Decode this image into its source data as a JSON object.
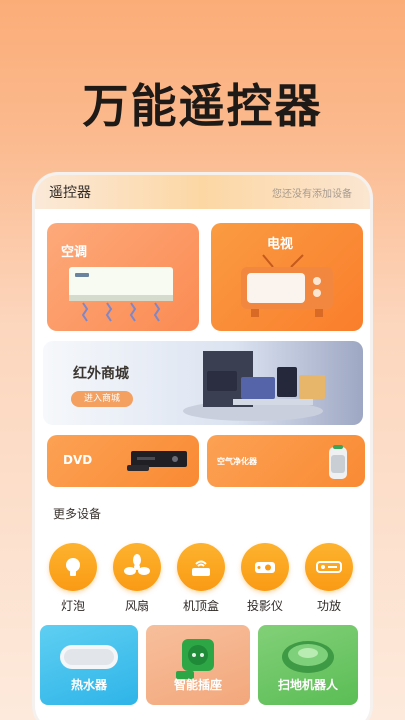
{
  "hero": {
    "title": "万能遥控器"
  },
  "header": {
    "title": "遥控器",
    "subtitle": "您还没有添加设备"
  },
  "cards": {
    "ac": {
      "label": "空调"
    },
    "tv": {
      "label": "电视"
    },
    "mall": {
      "label": "红外商城",
      "button": "进入商城"
    },
    "dvd": {
      "label": "DVD"
    },
    "air": {
      "label": "空气净化器"
    }
  },
  "more": {
    "title": "更多设备",
    "items": [
      {
        "label": "灯泡",
        "icon": "bulb-icon"
      },
      {
        "label": "风扇",
        "icon": "fan-icon"
      },
      {
        "label": "机顶盒",
        "icon": "router-icon"
      },
      {
        "label": "投影仪",
        "icon": "projector-icon"
      },
      {
        "label": "功放",
        "icon": "amplifier-icon"
      }
    ]
  },
  "tiles": {
    "heater": {
      "label": "热水器"
    },
    "socket": {
      "label": "智能插座"
    },
    "robot": {
      "label": "扫地机器人"
    }
  },
  "colors": {
    "accent": "#fa9a14",
    "hero_bg": "#fbad78"
  }
}
